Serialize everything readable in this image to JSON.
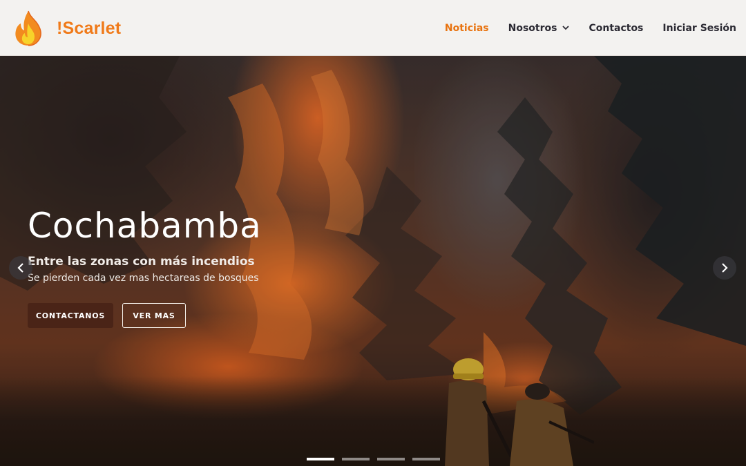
{
  "brand": {
    "name": "!Scarlet",
    "logo_icon": "flame-icon",
    "color": "#f07a19"
  },
  "nav": {
    "items": [
      {
        "label": "Noticias",
        "active": true
      },
      {
        "label": "Nosotros",
        "dropdown": true
      },
      {
        "label": "Contactos"
      },
      {
        "label": "Iniciar Sesión"
      }
    ],
    "active_color": "#e8730f"
  },
  "carousel": {
    "slide": {
      "title": "Cochabamba",
      "subtitle": "Entre las zonas con más incendios",
      "description": "Se pierden cada vez mas hectareas de bosques",
      "primary_button": "CONTACTANOS",
      "secondary_button": "VER MAS"
    },
    "prev_icon": "chevron-left-icon",
    "next_icon": "chevron-right-icon",
    "slide_count": 4,
    "active_index": 0
  }
}
